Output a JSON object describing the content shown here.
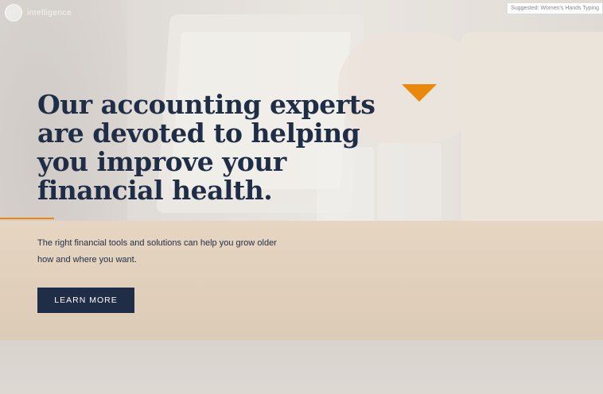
{
  "header": {
    "logo_text": "intelligence",
    "badge_text": "Suggested: Women's Hands Typing"
  },
  "hero": {
    "headline": "Our accounting experts are devoted to helping you improve your financial health.",
    "subtext": "The right financial tools and solutions can help you grow older how and where you want.",
    "cta_label": "LEARN MORE"
  },
  "colors": {
    "accent": "#e8890c",
    "navy": "#1f2e46"
  },
  "icons": {
    "accent_shape": "triangle-down-icon",
    "logo": "logo-icon"
  }
}
